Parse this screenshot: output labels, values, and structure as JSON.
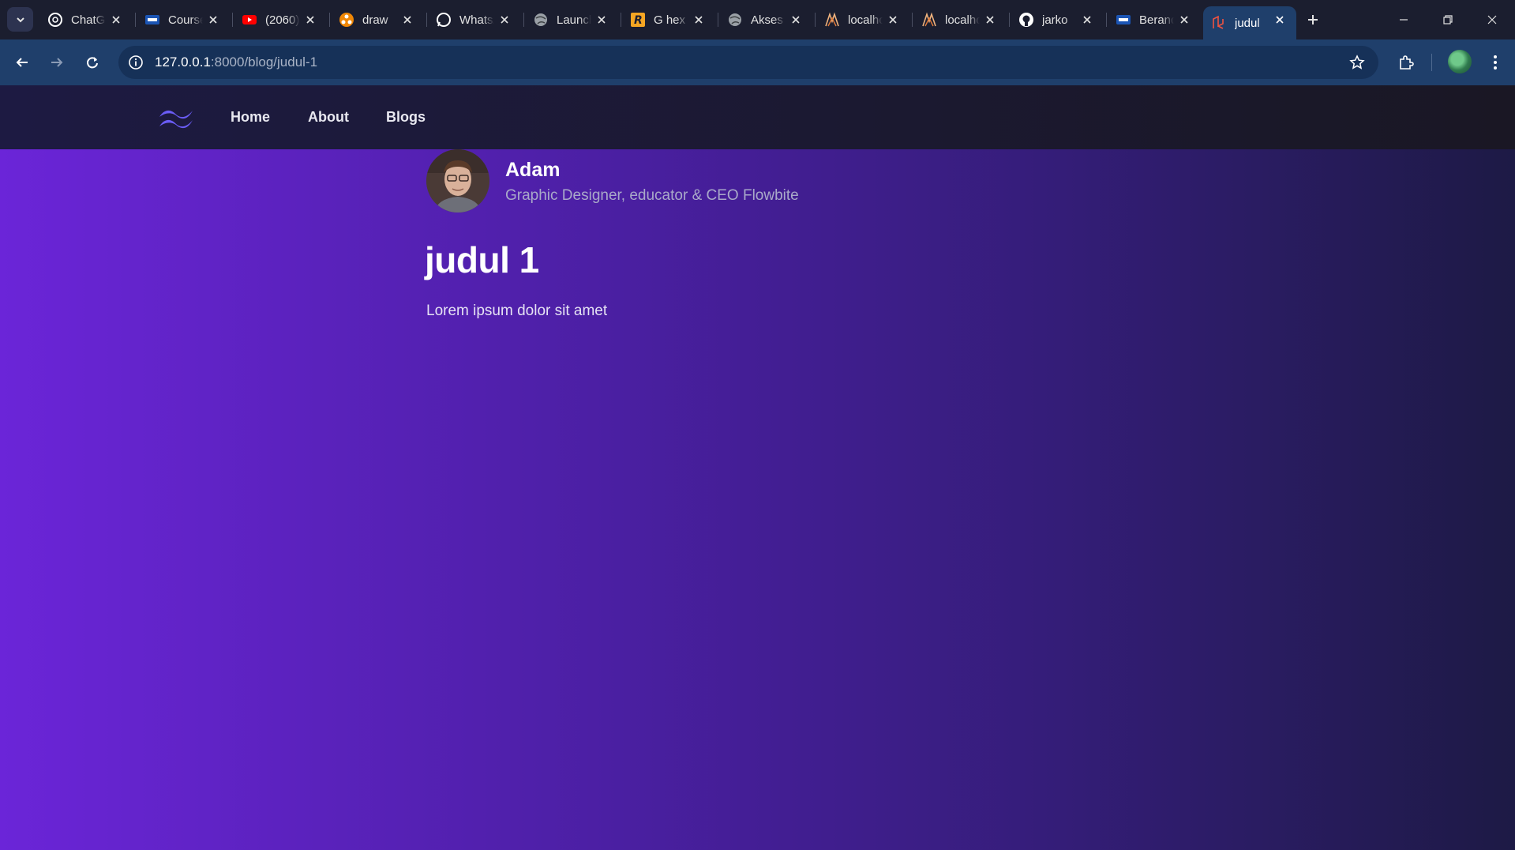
{
  "browser": {
    "tabs": [
      {
        "title": "ChatGPT",
        "icon": "chatgpt-icon"
      },
      {
        "title": "Courses",
        "icon": "its-icon"
      },
      {
        "title": "(2060)",
        "icon": "youtube-icon"
      },
      {
        "title": "draw",
        "icon": "drawio-icon"
      },
      {
        "title": "WhatsApp",
        "icon": "whatsapp-icon"
      },
      {
        "title": "Launch",
        "icon": "globe-icon"
      },
      {
        "title": "G hex",
        "icon": "r-icon"
      },
      {
        "title": "Akses",
        "icon": "globe-icon"
      },
      {
        "title": "localhost",
        "icon": "laravel-icon"
      },
      {
        "title": "localhost",
        "icon": "laravel-icon"
      },
      {
        "title": "jarko",
        "icon": "github-icon"
      },
      {
        "title": "Beranda",
        "icon": "its-icon"
      },
      {
        "title": "judul",
        "icon": "laravel-icon"
      }
    ],
    "active_tab": 12,
    "url_host": "127.0.0.1",
    "url_rest": ":8000/blog/judul-1"
  },
  "site": {
    "nav": {
      "links": [
        "Home",
        "About",
        "Blogs"
      ]
    },
    "author": {
      "name": "Adam",
      "role": "Graphic Designer, educator & CEO Flowbite"
    },
    "post": {
      "title": "judul 1",
      "body": "Lorem ipsum dolor sit amet"
    }
  },
  "colors": {
    "nav_bg": "#1b1930",
    "page_gradient_start": "#6b25d8",
    "page_gradient_end": "#1d1a45",
    "logo": "#6a5cf5"
  }
}
